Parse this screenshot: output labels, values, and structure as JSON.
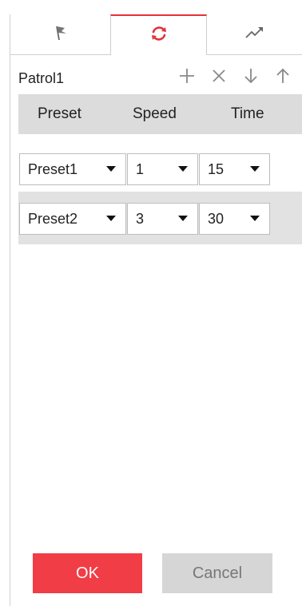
{
  "tabs": [
    {
      "icon": "flag-icon"
    },
    {
      "icon": "refresh-icon",
      "active": true
    },
    {
      "icon": "trend-icon"
    }
  ],
  "patrol": {
    "name": "Patrol1",
    "actions": [
      "add-icon",
      "close-icon",
      "arrow-down-icon",
      "arrow-up-icon"
    ]
  },
  "columns": {
    "preset": "Preset",
    "speed": "Speed",
    "time": "Time"
  },
  "rows": [
    {
      "preset": "Preset1",
      "speed": "1",
      "time": "15"
    },
    {
      "preset": "Preset2",
      "speed": "3",
      "time": "30"
    }
  ],
  "buttons": {
    "ok": "OK",
    "cancel": "Cancel"
  },
  "colors": {
    "accent": "#e53139",
    "ok_bg": "#f13d45",
    "cancel_bg": "#d6d6d6",
    "header_bg": "#dcdcdc"
  }
}
